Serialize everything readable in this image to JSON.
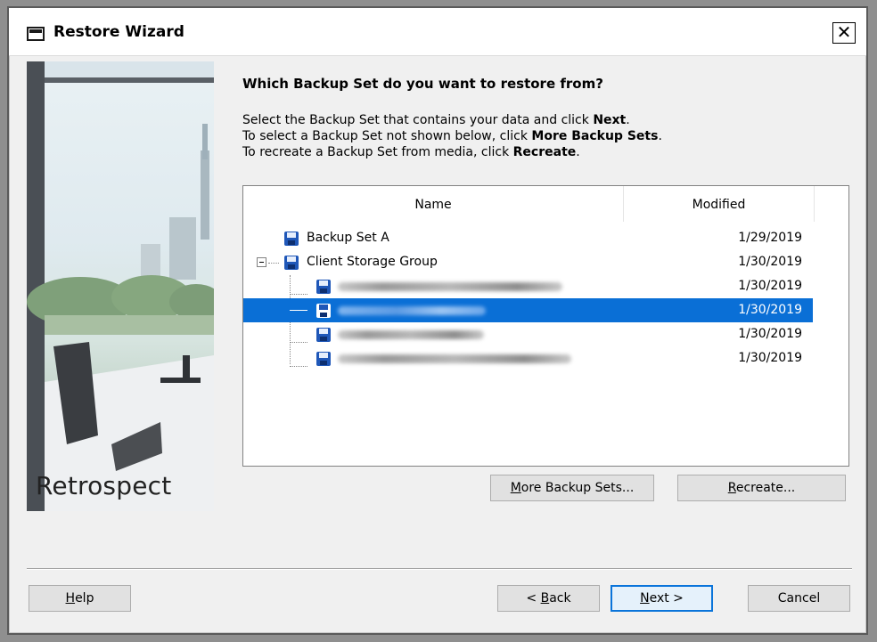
{
  "window": {
    "title": "Restore Wizard",
    "close_glyph": "✕"
  },
  "sidebar": {
    "brand": "Retrospect"
  },
  "main": {
    "heading": "Which Backup Set do you want to restore from?",
    "instructions": [
      {
        "pre": "Select the Backup Set that contains your data and click ",
        "bold": "Next",
        "post": "."
      },
      {
        "pre": "To select a Backup Set not shown below, click ",
        "bold": "More Backup Sets",
        "post": "."
      },
      {
        "pre": "To recreate a Backup Set from media, click ",
        "bold": "Recreate",
        "post": "."
      }
    ],
    "list": {
      "columns": [
        "Name",
        "Modified"
      ],
      "rows": [
        {
          "name": "Backup Set A",
          "modified": "1/29/2019",
          "level": 0,
          "selected": false,
          "redacted": false
        },
        {
          "name": "Client Storage Group",
          "modified": "1/30/2019",
          "level": 0,
          "selected": false,
          "redacted": false,
          "expanded": true
        },
        {
          "name": "",
          "modified": "1/30/2019",
          "level": 1,
          "selected": false,
          "redacted": true
        },
        {
          "name": "",
          "modified": "1/30/2019",
          "level": 1,
          "selected": true,
          "redacted": true
        },
        {
          "name": "",
          "modified": "1/30/2019",
          "level": 1,
          "selected": false,
          "redacted": true
        },
        {
          "name": "",
          "modified": "1/30/2019",
          "level": 1,
          "selected": false,
          "redacted": true
        }
      ]
    },
    "more_button": {
      "mnemonic": "M",
      "rest": "ore Backup Sets..."
    },
    "recreate_button": {
      "mnemonic": "R",
      "rest": "ecreate..."
    }
  },
  "footer": {
    "help": {
      "mnemonic": "H",
      "rest": "elp"
    },
    "back": {
      "pre": "< ",
      "mnemonic": "B",
      "rest": "ack"
    },
    "next": {
      "mnemonic": "N",
      "rest": "ext >"
    },
    "cancel": "Cancel"
  },
  "colors": {
    "selection": "#0a6fd6",
    "disk_icon": "#1f57b8",
    "default_button_border": "#0a74da"
  }
}
